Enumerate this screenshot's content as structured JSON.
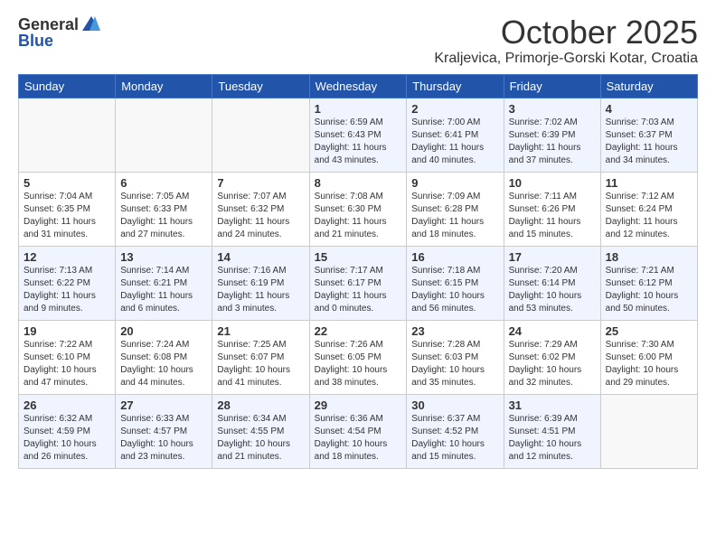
{
  "header": {
    "logo_general": "General",
    "logo_blue": "Blue",
    "month": "October 2025",
    "location": "Kraljevica, Primorje-Gorski Kotar, Croatia"
  },
  "days_of_week": [
    "Sunday",
    "Monday",
    "Tuesday",
    "Wednesday",
    "Thursday",
    "Friday",
    "Saturday"
  ],
  "weeks": [
    [
      {
        "num": "",
        "info": ""
      },
      {
        "num": "",
        "info": ""
      },
      {
        "num": "",
        "info": ""
      },
      {
        "num": "1",
        "info": "Sunrise: 6:59 AM\nSunset: 6:43 PM\nDaylight: 11 hours\nand 43 minutes."
      },
      {
        "num": "2",
        "info": "Sunrise: 7:00 AM\nSunset: 6:41 PM\nDaylight: 11 hours\nand 40 minutes."
      },
      {
        "num": "3",
        "info": "Sunrise: 7:02 AM\nSunset: 6:39 PM\nDaylight: 11 hours\nand 37 minutes."
      },
      {
        "num": "4",
        "info": "Sunrise: 7:03 AM\nSunset: 6:37 PM\nDaylight: 11 hours\nand 34 minutes."
      }
    ],
    [
      {
        "num": "5",
        "info": "Sunrise: 7:04 AM\nSunset: 6:35 PM\nDaylight: 11 hours\nand 31 minutes."
      },
      {
        "num": "6",
        "info": "Sunrise: 7:05 AM\nSunset: 6:33 PM\nDaylight: 11 hours\nand 27 minutes."
      },
      {
        "num": "7",
        "info": "Sunrise: 7:07 AM\nSunset: 6:32 PM\nDaylight: 11 hours\nand 24 minutes."
      },
      {
        "num": "8",
        "info": "Sunrise: 7:08 AM\nSunset: 6:30 PM\nDaylight: 11 hours\nand 21 minutes."
      },
      {
        "num": "9",
        "info": "Sunrise: 7:09 AM\nSunset: 6:28 PM\nDaylight: 11 hours\nand 18 minutes."
      },
      {
        "num": "10",
        "info": "Sunrise: 7:11 AM\nSunset: 6:26 PM\nDaylight: 11 hours\nand 15 minutes."
      },
      {
        "num": "11",
        "info": "Sunrise: 7:12 AM\nSunset: 6:24 PM\nDaylight: 11 hours\nand 12 minutes."
      }
    ],
    [
      {
        "num": "12",
        "info": "Sunrise: 7:13 AM\nSunset: 6:22 PM\nDaylight: 11 hours\nand 9 minutes."
      },
      {
        "num": "13",
        "info": "Sunrise: 7:14 AM\nSunset: 6:21 PM\nDaylight: 11 hours\nand 6 minutes."
      },
      {
        "num": "14",
        "info": "Sunrise: 7:16 AM\nSunset: 6:19 PM\nDaylight: 11 hours\nand 3 minutes."
      },
      {
        "num": "15",
        "info": "Sunrise: 7:17 AM\nSunset: 6:17 PM\nDaylight: 11 hours\nand 0 minutes."
      },
      {
        "num": "16",
        "info": "Sunrise: 7:18 AM\nSunset: 6:15 PM\nDaylight: 10 hours\nand 56 minutes."
      },
      {
        "num": "17",
        "info": "Sunrise: 7:20 AM\nSunset: 6:14 PM\nDaylight: 10 hours\nand 53 minutes."
      },
      {
        "num": "18",
        "info": "Sunrise: 7:21 AM\nSunset: 6:12 PM\nDaylight: 10 hours\nand 50 minutes."
      }
    ],
    [
      {
        "num": "19",
        "info": "Sunrise: 7:22 AM\nSunset: 6:10 PM\nDaylight: 10 hours\nand 47 minutes."
      },
      {
        "num": "20",
        "info": "Sunrise: 7:24 AM\nSunset: 6:08 PM\nDaylight: 10 hours\nand 44 minutes."
      },
      {
        "num": "21",
        "info": "Sunrise: 7:25 AM\nSunset: 6:07 PM\nDaylight: 10 hours\nand 41 minutes."
      },
      {
        "num": "22",
        "info": "Sunrise: 7:26 AM\nSunset: 6:05 PM\nDaylight: 10 hours\nand 38 minutes."
      },
      {
        "num": "23",
        "info": "Sunrise: 7:28 AM\nSunset: 6:03 PM\nDaylight: 10 hours\nand 35 minutes."
      },
      {
        "num": "24",
        "info": "Sunrise: 7:29 AM\nSunset: 6:02 PM\nDaylight: 10 hours\nand 32 minutes."
      },
      {
        "num": "25",
        "info": "Sunrise: 7:30 AM\nSunset: 6:00 PM\nDaylight: 10 hours\nand 29 minutes."
      }
    ],
    [
      {
        "num": "26",
        "info": "Sunrise: 6:32 AM\nSunset: 4:59 PM\nDaylight: 10 hours\nand 26 minutes."
      },
      {
        "num": "27",
        "info": "Sunrise: 6:33 AM\nSunset: 4:57 PM\nDaylight: 10 hours\nand 23 minutes."
      },
      {
        "num": "28",
        "info": "Sunrise: 6:34 AM\nSunset: 4:55 PM\nDaylight: 10 hours\nand 21 minutes."
      },
      {
        "num": "29",
        "info": "Sunrise: 6:36 AM\nSunset: 4:54 PM\nDaylight: 10 hours\nand 18 minutes."
      },
      {
        "num": "30",
        "info": "Sunrise: 6:37 AM\nSunset: 4:52 PM\nDaylight: 10 hours\nand 15 minutes."
      },
      {
        "num": "31",
        "info": "Sunrise: 6:39 AM\nSunset: 4:51 PM\nDaylight: 10 hours\nand 12 minutes."
      },
      {
        "num": "",
        "info": ""
      }
    ]
  ]
}
